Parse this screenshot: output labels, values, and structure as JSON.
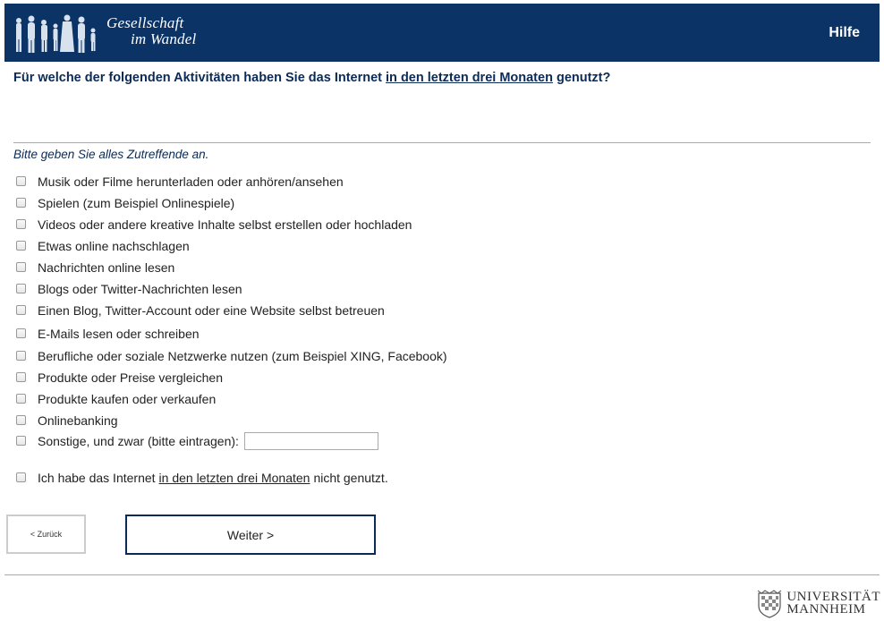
{
  "header": {
    "logo_line1": "Gesellschaft",
    "logo_line2": "im Wandel",
    "help_label": "Hilfe",
    "bg_color": "#0b3366"
  },
  "question": {
    "part1": "Für welche der folgenden Aktivitäten haben Sie das Internet ",
    "underlined": "in den letzten drei Monaten",
    "part2": " genutzt?"
  },
  "hint": "Bitte geben Sie alles Zutreffende an.",
  "options": [
    "Musik oder Filme herunterladen oder anhören/ansehen",
    "Spielen (zum Beispiel Onlinespiele)",
    "Videos oder andere kreative Inhalte selbst erstellen oder hochladen",
    "Etwas online nachschlagen",
    "Nachrichten online lesen",
    "Blogs oder Twitter-Nachrichten lesen",
    "Einen Blog, Twitter-Account oder eine Website selbst betreuen",
    "E-Mails lesen oder schreiben",
    "Berufliche oder soziale Netzwerke nutzen (zum Beispiel XING, Facebook)",
    "Produkte oder Preise vergleichen",
    "Produkte kaufen oder verkaufen",
    "Onlinebanking"
  ],
  "other_label": "Sonstige, und zwar (bitte eintragen):",
  "other_value": "",
  "none_option": {
    "part1": "Ich habe das Internet ",
    "underlined": "in den letzten drei Monaten",
    "part2": " nicht genutzt."
  },
  "buttons": {
    "back": "< Zurück",
    "next": "Weiter >"
  },
  "footer": {
    "uni_line1": "UNIVERSITÄT",
    "uni_line2": "MANNHEIM"
  }
}
